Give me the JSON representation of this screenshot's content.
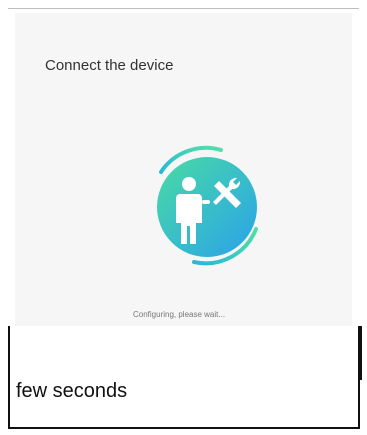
{
  "screen": {
    "title": "Connect the device",
    "status": "Configuring, please wait..."
  },
  "caption": {
    "text": "few seconds"
  },
  "icons": {
    "center_icon": "person-with-wrench-icon",
    "progress_ring": "spinner-ring"
  },
  "colors": {
    "gradient_start": "#43d2a5",
    "gradient_end": "#2ea8e6",
    "background": "#f6f6f6",
    "title_text": "#333333",
    "status_text": "#777777"
  }
}
